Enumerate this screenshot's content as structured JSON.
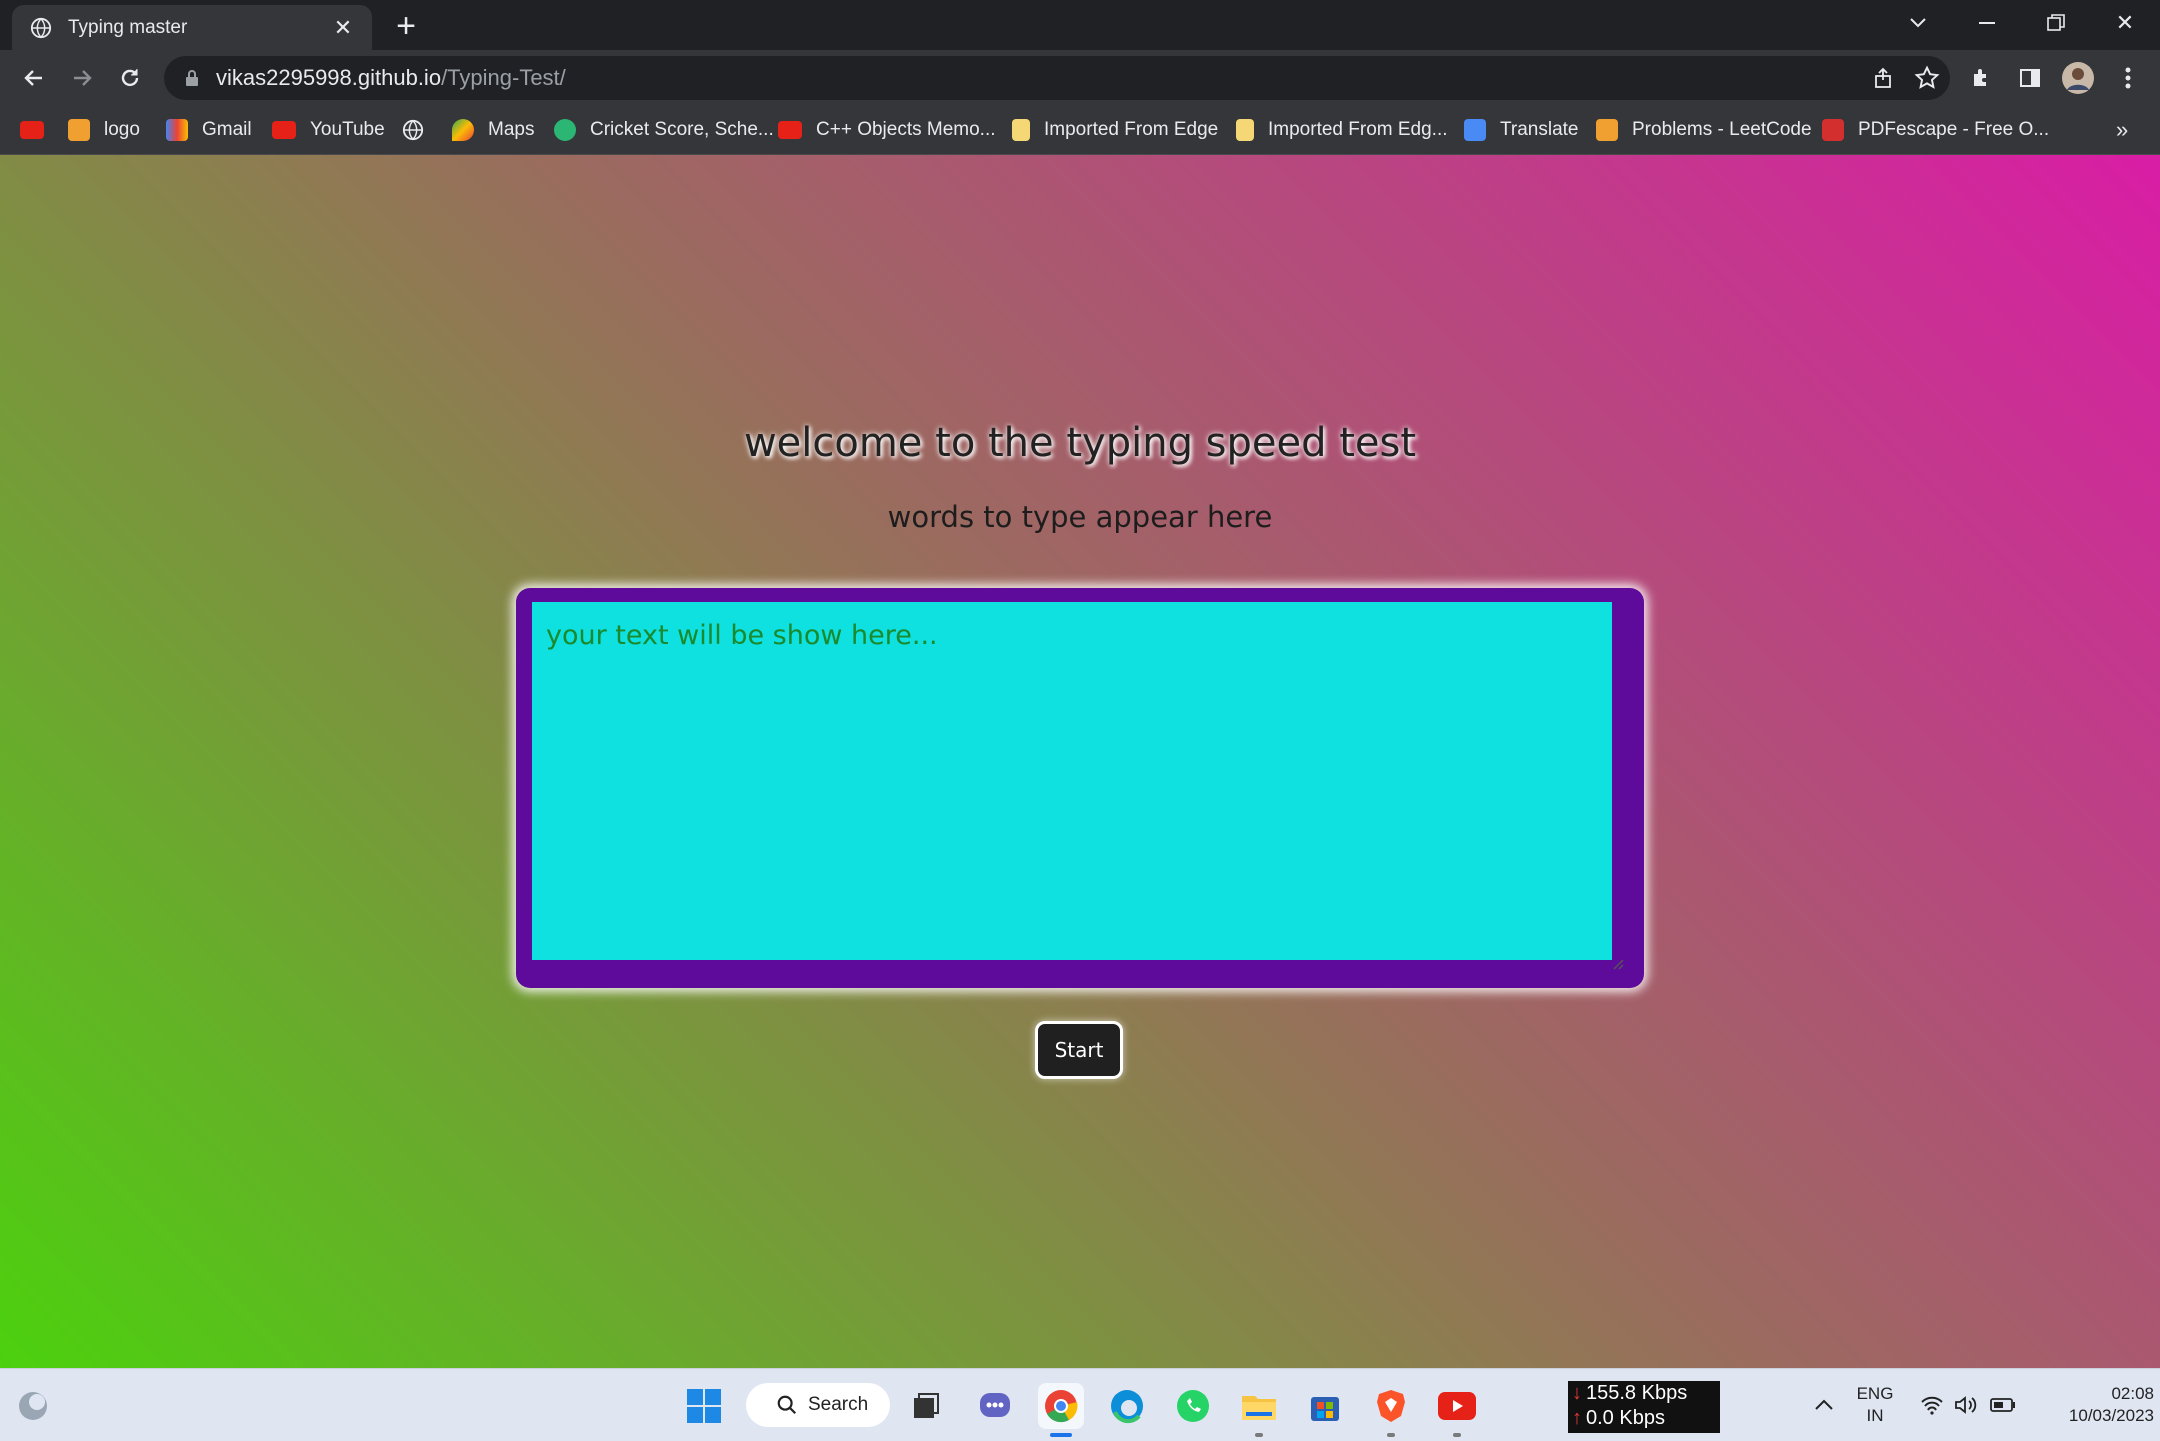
{
  "browser": {
    "tab_title": "Typing master",
    "url_host": "vikas2295998.github.io",
    "url_path": "/Typing-Test/",
    "bookmarks": [
      {
        "label": ""
      },
      {
        "label": "logo"
      },
      {
        "label": "Gmail"
      },
      {
        "label": "YouTube"
      },
      {
        "label": ""
      },
      {
        "label": "Maps"
      },
      {
        "label": "Cricket Score, Sche..."
      },
      {
        "label": "C++ Objects Memo..."
      },
      {
        "label": "Imported From Edge"
      },
      {
        "label": "Imported From Edg..."
      },
      {
        "label": "Translate"
      },
      {
        "label": "Problems - LeetCode"
      },
      {
        "label": "PDFescape - Free O..."
      }
    ],
    "overflow": "»"
  },
  "page": {
    "heading": "welcome to the typing speed test",
    "words_prompt": "words to type appear here",
    "textarea_placeholder": "your text will be show here...",
    "start_label": "Start"
  },
  "taskbar": {
    "search_label": "Search",
    "net_down": "155.8 Kbps",
    "net_up": "0.0 Kbps",
    "lang": "ENG",
    "region": "IN",
    "time": "02:08",
    "date": "10/03/2023"
  },
  "colors": {
    "gradient_start": "#4cd10e",
    "gradient_end": "#d91da5",
    "textarea_bg": "#0fe0e0",
    "textarea_frame": "#5e0a9a"
  }
}
